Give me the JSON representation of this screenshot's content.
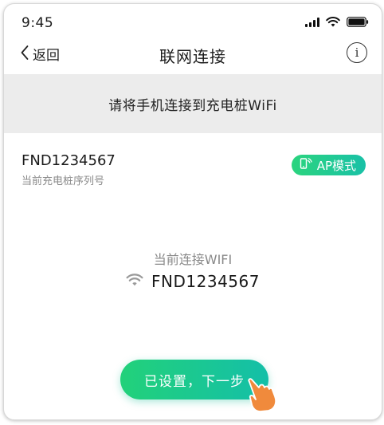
{
  "status_bar": {
    "time": "9:45"
  },
  "nav": {
    "back_label": "返回",
    "title": "联网连接",
    "info_icon": "info-icon"
  },
  "banner": {
    "text": "请将手机连接到充电桩WiFi"
  },
  "device": {
    "serial": "FND1234567",
    "serial_label": "当前充电桩序列号",
    "mode_badge": "AP模式"
  },
  "wifi": {
    "label": "当前连接WIFI",
    "ssid": "FND1234567"
  },
  "actions": {
    "next_label": "已设置，下一步"
  },
  "colors": {
    "accent_start": "#22d17a",
    "accent_end": "#14bfa8",
    "banner_bg": "#ececec",
    "hand": "#f08a3c"
  }
}
